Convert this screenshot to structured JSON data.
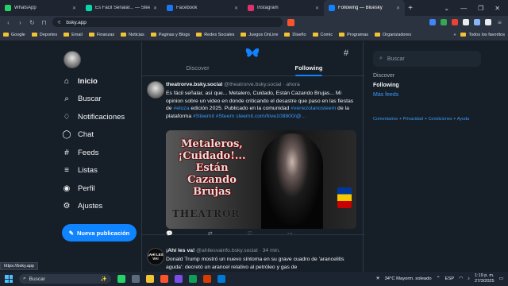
{
  "browser": {
    "tabs": [
      {
        "title": "WhatsApp",
        "favicon_color": "#25d366",
        "active": false
      },
      {
        "title": "Es Fácil Señalar... — Steemit",
        "favicon_color": "#06d6a9",
        "active": false
      },
      {
        "title": "Facebook",
        "favicon_color": "#1877f2",
        "active": false
      },
      {
        "title": "Instagram",
        "favicon_color": "#e1306c",
        "active": false
      },
      {
        "title": "Following — Bluesky",
        "favicon_color": "#1083fe",
        "active": true
      }
    ],
    "new_tab": "+",
    "window_controls": [
      "⌄",
      "—",
      "❐",
      "✕"
    ],
    "url": "bsky.app",
    "bookmarks": [
      "Google",
      "Deportes",
      "Email",
      "Finanzas",
      "Noticias",
      "Paginas y Blogs",
      "Redes Sociales",
      "Juegos OnLine",
      "Diseño",
      "Comic",
      "Programas",
      "Organizadores"
    ],
    "bookmarks_more": "»",
    "all_bookmarks": "Todos los favoritos",
    "status_url": "https://bsky.app"
  },
  "nav": {
    "items": [
      {
        "label": "Inicio",
        "icon": "home-icon",
        "glyph": "⌂",
        "bold": true
      },
      {
        "label": "Buscar",
        "icon": "search-icon",
        "glyph": "⌕",
        "bold": false
      },
      {
        "label": "Notificaciones",
        "icon": "bell-icon",
        "glyph": "♢",
        "bold": false
      },
      {
        "label": "Chat",
        "icon": "chat-icon",
        "glyph": "◯",
        "bold": false
      },
      {
        "label": "Feeds",
        "icon": "hash-icon",
        "glyph": "#",
        "bold": false
      },
      {
        "label": "Listas",
        "icon": "list-icon",
        "glyph": "≡",
        "bold": false
      },
      {
        "label": "Perfil",
        "icon": "user-icon",
        "glyph": "◉",
        "bold": false
      },
      {
        "label": "Ajustes",
        "icon": "gear-icon",
        "glyph": "⚙",
        "bold": false
      }
    ],
    "post_button": "Nueva publicación"
  },
  "feed": {
    "tabs": [
      {
        "label": "Discover",
        "selected": false
      },
      {
        "label": "Following",
        "selected": true
      }
    ],
    "post1": {
      "display_name": "theatrorve.bsky.social",
      "handle": "@theatrorve.bsky.social",
      "separator": "·",
      "time": "ahora",
      "text_1": "Es fácil señalar, así que... Metalero, Cuidado, Están Cazando Brujas... Mi opinion sobre un video en donde criticando el desastre que paso en las fiestas de ",
      "tag_1": "#eloza",
      "text_2": " edición 2025. Publicado en la comunidad ",
      "tag_2": "#venezolanosteem",
      "text_3": " de la plataforma ",
      "tag_3": "#Steemit",
      "text_4": " ",
      "tag_4": "#Steem",
      "text_5": " ",
      "link": "steemit.com/hive108800/@...",
      "image_title": "Metaleros, ¡Cuidado!... Están Cazando Brujas",
      "image_brand": "THEATROR",
      "actions": [
        "💬",
        "⇄",
        "♡",
        "⋯"
      ]
    },
    "post2": {
      "avatar_text": "¡AHÍ LES VA!",
      "display_name": "¡Ahí les va!",
      "handle": "@ahilesvainfo.bsky.social",
      "separator": "·",
      "time": "34 min.",
      "text": "Donald Trump mostró un nuevo síntoma en su grave cuadro de 'arancelitis aguda': decretó un arancel relativo al petróleo y gas de"
    }
  },
  "right": {
    "search_placeholder": "Buscar",
    "links": [
      "Discover",
      "Following",
      "Más feeds"
    ],
    "footer": [
      "Comentarios",
      "Privacidad",
      "Condiciones",
      "Ayuda"
    ],
    "footer_sep": "+"
  },
  "taskbar": {
    "search": "Buscar",
    "weather": "34°C  Mayorm. soleado",
    "lang": "ESP",
    "time": "1:19 p. m.",
    "date": "27/3/2025"
  }
}
